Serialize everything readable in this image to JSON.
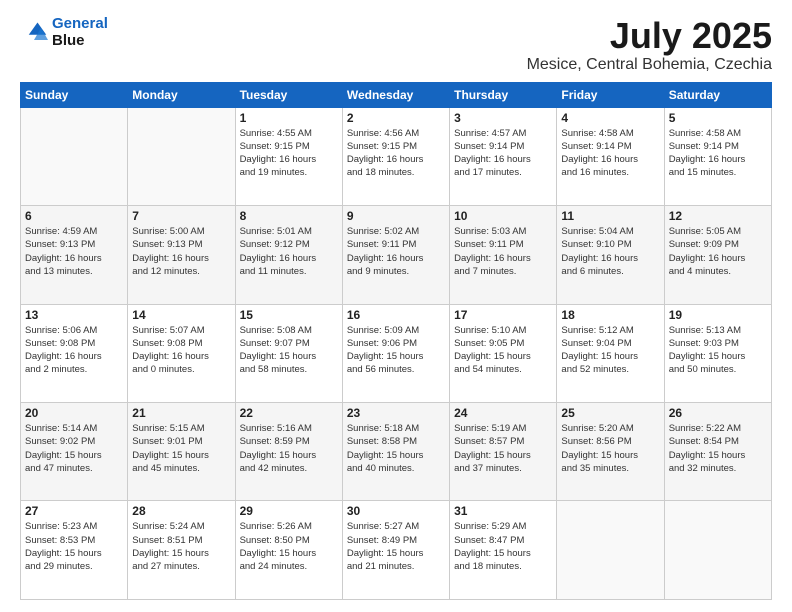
{
  "header": {
    "logo_line1": "General",
    "logo_line2": "Blue",
    "month": "July 2025",
    "location": "Mesice, Central Bohemia, Czechia"
  },
  "weekdays": [
    "Sunday",
    "Monday",
    "Tuesday",
    "Wednesday",
    "Thursday",
    "Friday",
    "Saturday"
  ],
  "weeks": [
    [
      {
        "day": "",
        "info": ""
      },
      {
        "day": "",
        "info": ""
      },
      {
        "day": "1",
        "info": "Sunrise: 4:55 AM\nSunset: 9:15 PM\nDaylight: 16 hours\nand 19 minutes."
      },
      {
        "day": "2",
        "info": "Sunrise: 4:56 AM\nSunset: 9:15 PM\nDaylight: 16 hours\nand 18 minutes."
      },
      {
        "day": "3",
        "info": "Sunrise: 4:57 AM\nSunset: 9:14 PM\nDaylight: 16 hours\nand 17 minutes."
      },
      {
        "day": "4",
        "info": "Sunrise: 4:58 AM\nSunset: 9:14 PM\nDaylight: 16 hours\nand 16 minutes."
      },
      {
        "day": "5",
        "info": "Sunrise: 4:58 AM\nSunset: 9:14 PM\nDaylight: 16 hours\nand 15 minutes."
      }
    ],
    [
      {
        "day": "6",
        "info": "Sunrise: 4:59 AM\nSunset: 9:13 PM\nDaylight: 16 hours\nand 13 minutes."
      },
      {
        "day": "7",
        "info": "Sunrise: 5:00 AM\nSunset: 9:13 PM\nDaylight: 16 hours\nand 12 minutes."
      },
      {
        "day": "8",
        "info": "Sunrise: 5:01 AM\nSunset: 9:12 PM\nDaylight: 16 hours\nand 11 minutes."
      },
      {
        "day": "9",
        "info": "Sunrise: 5:02 AM\nSunset: 9:11 PM\nDaylight: 16 hours\nand 9 minutes."
      },
      {
        "day": "10",
        "info": "Sunrise: 5:03 AM\nSunset: 9:11 PM\nDaylight: 16 hours\nand 7 minutes."
      },
      {
        "day": "11",
        "info": "Sunrise: 5:04 AM\nSunset: 9:10 PM\nDaylight: 16 hours\nand 6 minutes."
      },
      {
        "day": "12",
        "info": "Sunrise: 5:05 AM\nSunset: 9:09 PM\nDaylight: 16 hours\nand 4 minutes."
      }
    ],
    [
      {
        "day": "13",
        "info": "Sunrise: 5:06 AM\nSunset: 9:08 PM\nDaylight: 16 hours\nand 2 minutes."
      },
      {
        "day": "14",
        "info": "Sunrise: 5:07 AM\nSunset: 9:08 PM\nDaylight: 16 hours\nand 0 minutes."
      },
      {
        "day": "15",
        "info": "Sunrise: 5:08 AM\nSunset: 9:07 PM\nDaylight: 15 hours\nand 58 minutes."
      },
      {
        "day": "16",
        "info": "Sunrise: 5:09 AM\nSunset: 9:06 PM\nDaylight: 15 hours\nand 56 minutes."
      },
      {
        "day": "17",
        "info": "Sunrise: 5:10 AM\nSunset: 9:05 PM\nDaylight: 15 hours\nand 54 minutes."
      },
      {
        "day": "18",
        "info": "Sunrise: 5:12 AM\nSunset: 9:04 PM\nDaylight: 15 hours\nand 52 minutes."
      },
      {
        "day": "19",
        "info": "Sunrise: 5:13 AM\nSunset: 9:03 PM\nDaylight: 15 hours\nand 50 minutes."
      }
    ],
    [
      {
        "day": "20",
        "info": "Sunrise: 5:14 AM\nSunset: 9:02 PM\nDaylight: 15 hours\nand 47 minutes."
      },
      {
        "day": "21",
        "info": "Sunrise: 5:15 AM\nSunset: 9:01 PM\nDaylight: 15 hours\nand 45 minutes."
      },
      {
        "day": "22",
        "info": "Sunrise: 5:16 AM\nSunset: 8:59 PM\nDaylight: 15 hours\nand 42 minutes."
      },
      {
        "day": "23",
        "info": "Sunrise: 5:18 AM\nSunset: 8:58 PM\nDaylight: 15 hours\nand 40 minutes."
      },
      {
        "day": "24",
        "info": "Sunrise: 5:19 AM\nSunset: 8:57 PM\nDaylight: 15 hours\nand 37 minutes."
      },
      {
        "day": "25",
        "info": "Sunrise: 5:20 AM\nSunset: 8:56 PM\nDaylight: 15 hours\nand 35 minutes."
      },
      {
        "day": "26",
        "info": "Sunrise: 5:22 AM\nSunset: 8:54 PM\nDaylight: 15 hours\nand 32 minutes."
      }
    ],
    [
      {
        "day": "27",
        "info": "Sunrise: 5:23 AM\nSunset: 8:53 PM\nDaylight: 15 hours\nand 29 minutes."
      },
      {
        "day": "28",
        "info": "Sunrise: 5:24 AM\nSunset: 8:51 PM\nDaylight: 15 hours\nand 27 minutes."
      },
      {
        "day": "29",
        "info": "Sunrise: 5:26 AM\nSunset: 8:50 PM\nDaylight: 15 hours\nand 24 minutes."
      },
      {
        "day": "30",
        "info": "Sunrise: 5:27 AM\nSunset: 8:49 PM\nDaylight: 15 hours\nand 21 minutes."
      },
      {
        "day": "31",
        "info": "Sunrise: 5:29 AM\nSunset: 8:47 PM\nDaylight: 15 hours\nand 18 minutes."
      },
      {
        "day": "",
        "info": ""
      },
      {
        "day": "",
        "info": ""
      }
    ]
  ]
}
